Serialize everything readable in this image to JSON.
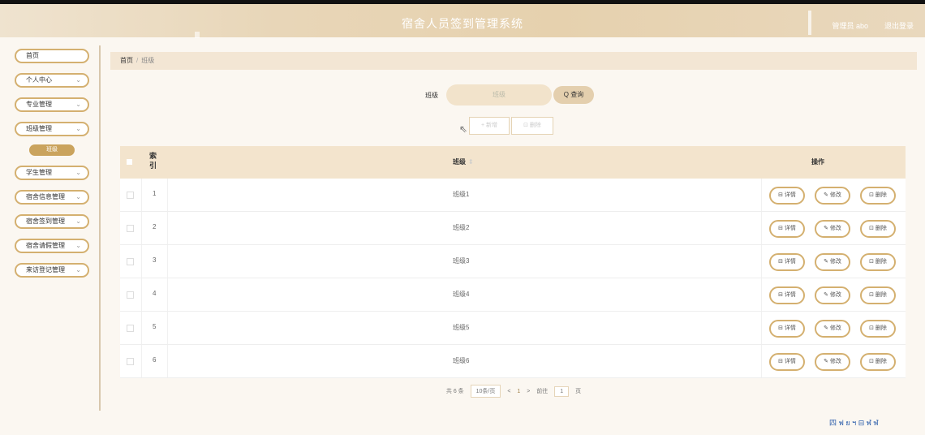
{
  "header": {
    "title": "宿舍人员签到管理系统",
    "user": "管理员 abo",
    "logout": "退出登录"
  },
  "sidebar": {
    "items": [
      {
        "label": "首页"
      },
      {
        "label": "个人中心"
      },
      {
        "label": "专业管理"
      },
      {
        "label": "班级管理"
      },
      {
        "label": "学生管理"
      },
      {
        "label": "宿舍信息管理"
      },
      {
        "label": "宿舍签到管理"
      },
      {
        "label": "宿舍请假管理"
      },
      {
        "label": "来访登记管理"
      }
    ],
    "sub_item": "班级"
  },
  "breadcrumb": {
    "home": "首页",
    "separator": "/",
    "current": "班级"
  },
  "search": {
    "label": "班级",
    "placeholder": "班级",
    "button": "Q 查询"
  },
  "actions": {
    "add": "+ 新增",
    "delete": "⊡ 删除"
  },
  "table": {
    "headers": {
      "index": "索引",
      "class": "班级",
      "sort": "⇕",
      "ops": "操作"
    },
    "rows": [
      {
        "index": "1",
        "name": "班级1"
      },
      {
        "index": "2",
        "name": "班级2"
      },
      {
        "index": "3",
        "name": "班级3"
      },
      {
        "index": "4",
        "name": "班级4"
      },
      {
        "index": "5",
        "name": "班级5"
      },
      {
        "index": "6",
        "name": "班级6"
      }
    ],
    "row_actions": {
      "detail": "⊟ 详情",
      "edit": "✎ 修改",
      "delete": "⊡ 删除"
    }
  },
  "pager": {
    "total": "共 6 条",
    "size": "10条/页",
    "prev": "<",
    "page": "1",
    "next": ">",
    "goto": "前往",
    "goto_page": "1",
    "unit": "页"
  },
  "ime": {
    "text": "四 ฟ ย ฯ ⊟ ฬ ฬ"
  }
}
